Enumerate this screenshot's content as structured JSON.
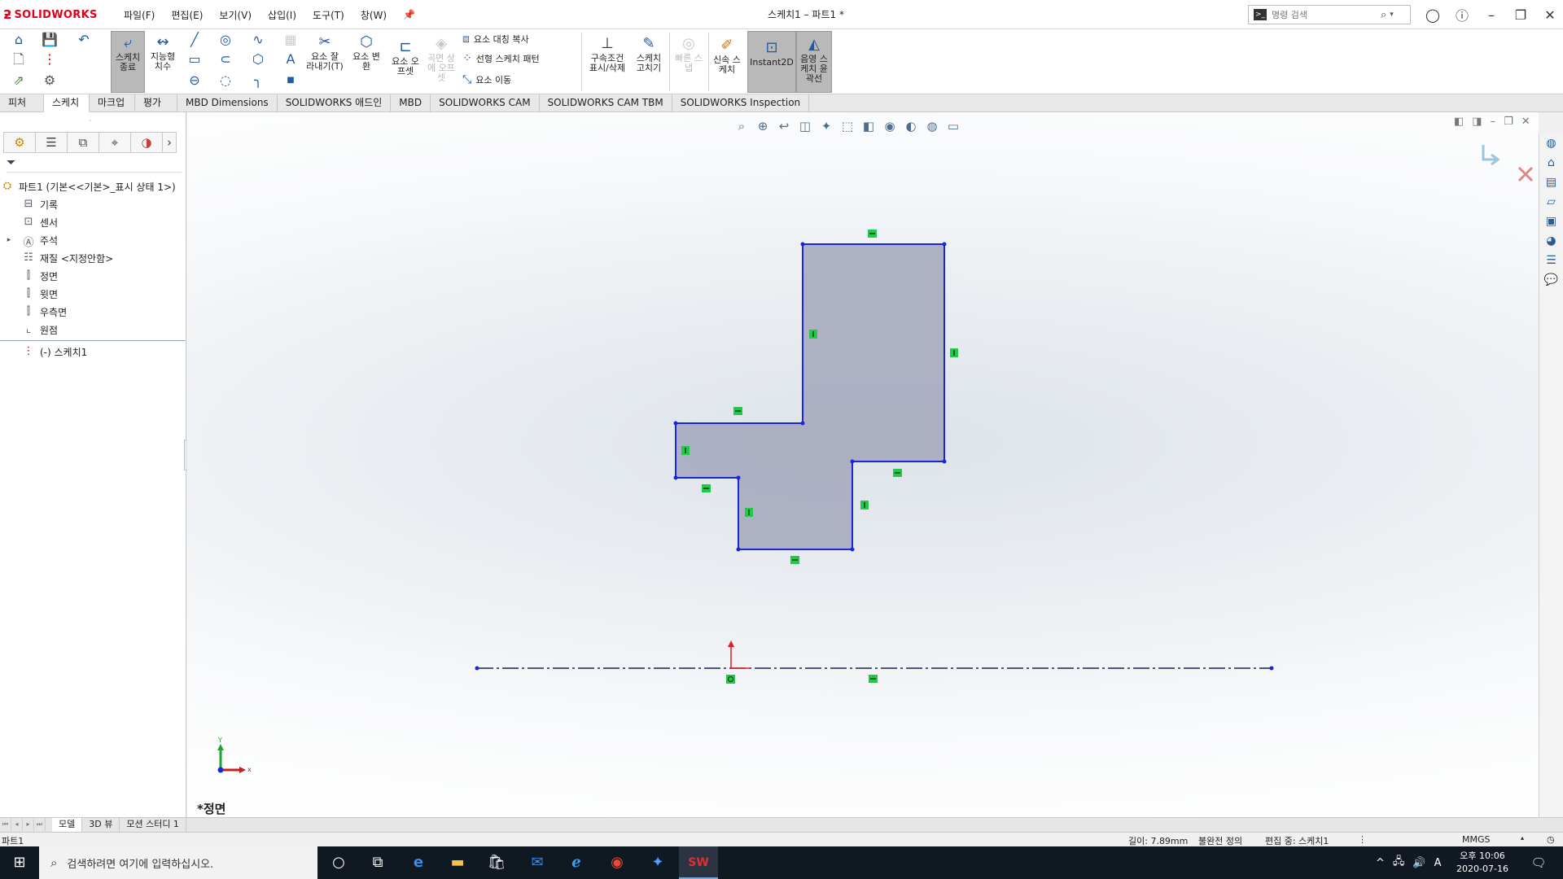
{
  "app": {
    "logo_ds": "ƻ",
    "brand": "SOLIDWORKS",
    "window_title": "스케치1 – 파트1 *"
  },
  "menus": [
    "파일(F)",
    "편집(E)",
    "보기(V)",
    "삽입(I)",
    "도구(T)",
    "창(W)"
  ],
  "search": {
    "placeholder": "명령 검색"
  },
  "ribbon": {
    "exit_sketch": "스케치\n종료",
    "smart_dim": "지능형\n치수",
    "trim": "요소 잘\n라내기(T)",
    "convert": "요소 변\n환",
    "offset": "요소 오\n프셋",
    "surface_offset": "곡면 상\n에 오프\n셋",
    "mirror": "요소 대칭 복사",
    "linear_pattern": "선형 스케치 패턴",
    "move": "요소 이동",
    "relations": "구속조건\n표시/삭제",
    "fix_sketch": "스케치\n고치기",
    "quick_snaps": "빠른 스\n냅",
    "rapid_sketch": "신속 스\n케치",
    "instant2d": "Instant2D",
    "shaded_contours": "음영 스\n케치 윤\n곽선"
  },
  "tabs": [
    "피처",
    "스케치",
    "마크업",
    "평가",
    "MBD Dimensions",
    "SOLIDWORKS 애드인",
    "MBD",
    "SOLIDWORKS CAM",
    "SOLIDWORKS CAM TBM",
    "SOLIDWORKS Inspection"
  ],
  "active_tab": "스케치",
  "tree": {
    "root": "파트1  (기본<<기본>_표시 상태 1>)",
    "items": [
      "기록",
      "센서",
      "주석",
      "재질 <지정안함>",
      "정면",
      "윗면",
      "우측면",
      "원점"
    ],
    "sketch": "(-) 스케치1"
  },
  "viewport": {
    "view_name": "*정면",
    "triad_x": "x",
    "triad_y": "Y"
  },
  "model_tabs": [
    "모델",
    "3D 뷰",
    "모션 스터디 1"
  ],
  "status": {
    "left": "파트1",
    "length": "길이: 7.89mm",
    "definition": "불완전 정의",
    "editing": "편집 중: 스케치1",
    "units": "MMGS"
  },
  "taskbar": {
    "search_placeholder": "검색하려면 여기에 입력하십시오.",
    "time": "오후 10:06",
    "date": "2020-07-16",
    "ime": "A"
  },
  "colors": {
    "sketch_line": "#1a26d8",
    "sketch_fill": "#a7aabf",
    "relation_icon": "#22c84a",
    "centerline": "#1a2050",
    "origin": "#e02020"
  }
}
